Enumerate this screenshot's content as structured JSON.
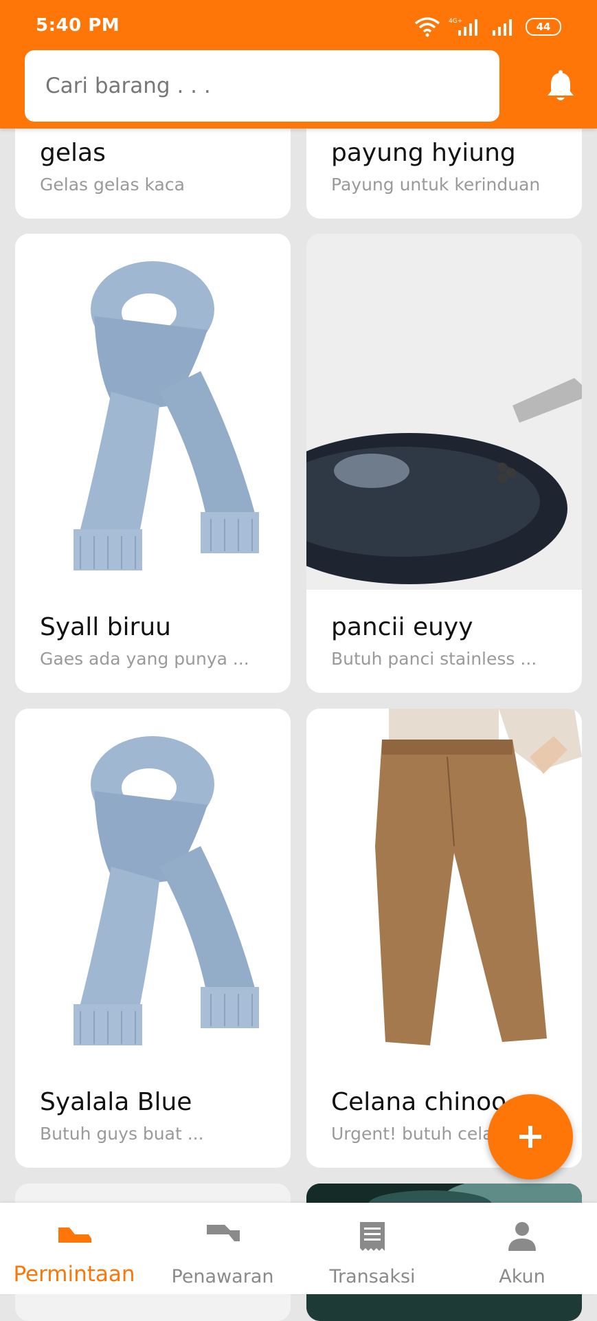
{
  "status_bar": {
    "time": "5:40 PM",
    "battery": "44",
    "network": "4G+"
  },
  "search": {
    "placeholder": "Cari barang . . ."
  },
  "cards": [
    {
      "title": "gelas",
      "description": "Gelas gelas kaca"
    },
    {
      "title": "payung hyiung",
      "description": "Payung untuk kerinduan"
    },
    {
      "title": "Syall biruu",
      "description": "Gaes ada yang punya ..."
    },
    {
      "title": "pancii euyy",
      "description": "Butuh panci stainless ..."
    },
    {
      "title": "Syalala Blue",
      "description": "Butuh guys buat ..."
    },
    {
      "title": "Celana chinoo",
      "description": "Urgent! butuh celana ..."
    }
  ],
  "bottom_nav": [
    {
      "label": "Permintaan",
      "icon": "request-icon",
      "active": true
    },
    {
      "label": "Penawaran",
      "icon": "offer-icon",
      "active": false
    },
    {
      "label": "Transaksi",
      "icon": "receipt-icon",
      "active": false
    },
    {
      "label": "Akun",
      "icon": "person-icon",
      "active": false
    }
  ],
  "colors": {
    "primary": "#ff7608",
    "background": "#e6e6e6"
  }
}
